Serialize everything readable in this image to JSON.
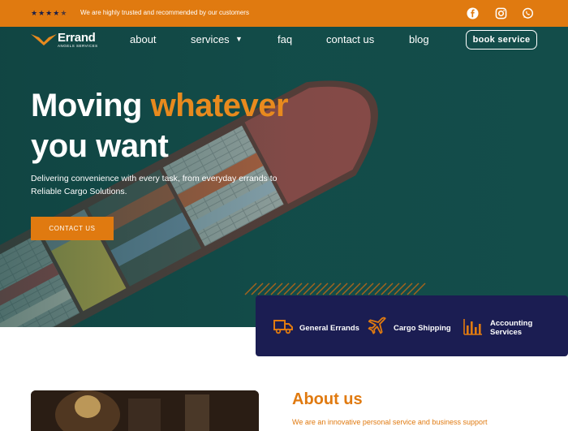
{
  "topbar": {
    "rating_stars": 4.5,
    "trust_text": "We are highly trusted and recommended by our customers",
    "social_icons": [
      "facebook-icon",
      "instagram-icon",
      "whatsapp-icon"
    ]
  },
  "brand": {
    "name": "Errand",
    "tagline": "ANGELS SERVICES"
  },
  "nav": {
    "about": "about",
    "services": "services",
    "faq": "faq",
    "contact": "contact us",
    "blog": "blog",
    "book": "book service"
  },
  "hero": {
    "headline_white_1": "Moving ",
    "headline_accent": "whatever",
    "headline_white_2": "you want",
    "subtext": "Delivering convenience with every task, from everyday errands to Reliable Cargo Solutions.",
    "cta": "CONTACT US"
  },
  "services": [
    {
      "label": "General Errands",
      "icon": "truck-icon"
    },
    {
      "label": "Cargo Shipping",
      "icon": "airplane-icon"
    },
    {
      "label": "Accounting Services",
      "icon": "bar-chart-icon"
    }
  ],
  "about": {
    "title": "About us",
    "text": "We are an innovative personal service and business support"
  },
  "colors": {
    "orange": "#e07a10",
    "teal": "#114a47",
    "navy": "#1b1d52"
  }
}
